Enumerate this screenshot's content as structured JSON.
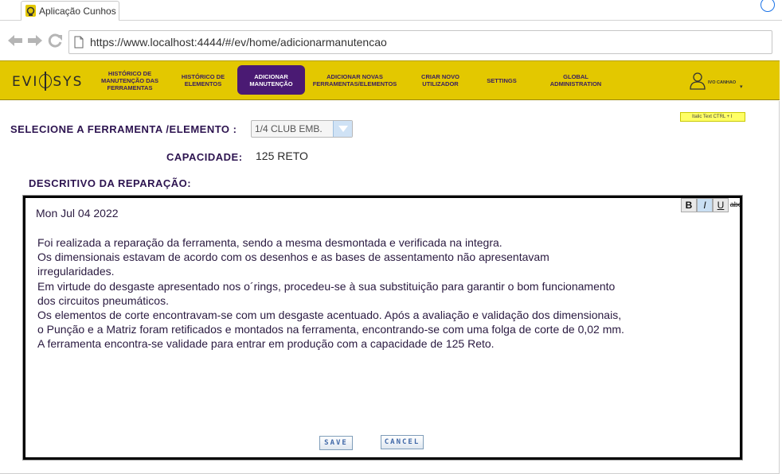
{
  "browser": {
    "tab_title": "Aplicação Cunhos",
    "url": "https://www.localhost:4444/#/ev/home/adicionarmanutencao"
  },
  "app": {
    "logo": {
      "pre": "EVI",
      "post": "SYS"
    },
    "menu": [
      {
        "label": "HISTÓRICO DE MANUTENÇÃO DAS FERRAMENTAS",
        "active": false
      },
      {
        "label": "HISTÓRICO DE ELEMENTOS",
        "active": false
      },
      {
        "label": "ADICIONAR MANUTENÇÃO",
        "active": true
      },
      {
        "label": "ADICIONAR NOVAS FERRAMENTAS/ELEMENTOS",
        "active": false
      },
      {
        "label": "CRIAR NOVO UTILIZADOR",
        "active": false
      },
      {
        "label": "SETTINGS",
        "active": false
      },
      {
        "label": "GLOBAL ADMINISTRATION",
        "active": false
      }
    ],
    "user_name": "IVO CANHAO",
    "accent_color": "#e3c800",
    "active_color": "#4a1a73"
  },
  "form": {
    "tool_label": "SELECIONE A FERRAMENTA /ELEMENTO :",
    "tool_value": "1/4 CLUB EMB.",
    "capacity_label": "CAPACIDADE:",
    "capacity_value": "125 RETO",
    "description_label": "DESCRITIVO DA REPARAÇÃO:"
  },
  "editor": {
    "toolbar": {
      "bold": "B",
      "italic": "I",
      "underline": "U",
      "strike": "abc"
    },
    "tooltip": "Italic Text CTRL + I",
    "date": "Mon Jul 04 2022",
    "lines": [
      "Foi realizada a reparação da ferramenta, sendo a mesma desmontada e verificada na integra.",
      "Os dimensionais estavam de acordo com os desenhos e as bases de assentamento não apresentavam",
      "irregularidades.",
      "Em virtude do desgaste apresentado nos o´rings, procedeu-se à sua substituição para garantir o bom funcionamento",
      "dos circuitos pneumáticos.",
      "Os elementos de corte encontravam-se com um desgaste acentuado. Após a avaliação e validação dos dimensionais,",
      "o Punção e a Matriz foram retificados e montados na ferramenta, encontrando-se com uma folga de corte de 0,02 mm.",
      "A ferramenta encontra-se validade para entrar em produção com a capacidade de 125 Reto."
    ]
  },
  "actions": {
    "save": "SAVE",
    "cancel": "CANCEL"
  }
}
